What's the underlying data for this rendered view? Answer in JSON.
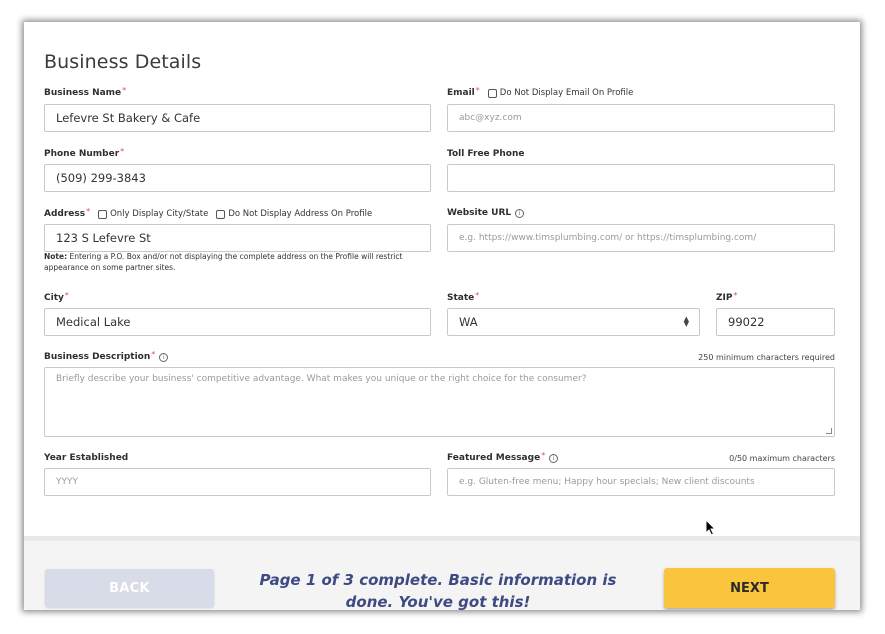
{
  "section_title": "Business Details",
  "business_name": {
    "label": "Business Name",
    "value": "Lefevre  St Bakery &  Cafe"
  },
  "email": {
    "label": "Email",
    "checkbox_label": "Do Not Display Email On Profile",
    "placeholder": "abc@xyz.com"
  },
  "phone": {
    "label": "Phone Number",
    "value": "(509) 299-3843"
  },
  "toll_free": {
    "label": "Toll Free Phone",
    "value": ""
  },
  "address": {
    "label": "Address",
    "checkbox_city_state": "Only Display City/State",
    "checkbox_hide": "Do Not Display Address On Profile",
    "value": "123 S Lefevre St",
    "note_bold": "Note:",
    "note_text": " Entering a P.O. Box and/or not displaying the complete address on the Profile will restrict appearance on some partner sites."
  },
  "website": {
    "label": "Website URL",
    "placeholder": "e.g. https://www.timsplumbing.com/ or https://timsplumbing.com/"
  },
  "city": {
    "label": "City",
    "value": "Medical Lake"
  },
  "state": {
    "label": "State",
    "value": "WA"
  },
  "zip": {
    "label": "ZIP",
    "value": "99022"
  },
  "description": {
    "label": "Business Description",
    "hint": "250 minimum characters required",
    "placeholder": "Briefly describe your business' competitive advantage. What makes you unique or the right choice for the consumer?"
  },
  "year": {
    "label": "Year Established",
    "placeholder": "YYYY"
  },
  "featured": {
    "label": "Featured Message",
    "hint": "0/50 maximum characters",
    "placeholder": "e.g. Gluten-free menu; Happy hour specials; New client discounts"
  },
  "footer": {
    "back_label": "BACK",
    "progress_text": "Page 1 of 3 complete. Basic information is done. You've got this!",
    "next_label": "NEXT"
  },
  "colors": {
    "required": "#d9534f",
    "next": "#fbc43d",
    "back": "#d8dce9",
    "progress_text": "#3e4a82"
  },
  "icons": [
    "info-icon",
    "checkbox-icon",
    "select-arrows-icon",
    "mouse-cursor-icon",
    "resize-grip-icon"
  ]
}
